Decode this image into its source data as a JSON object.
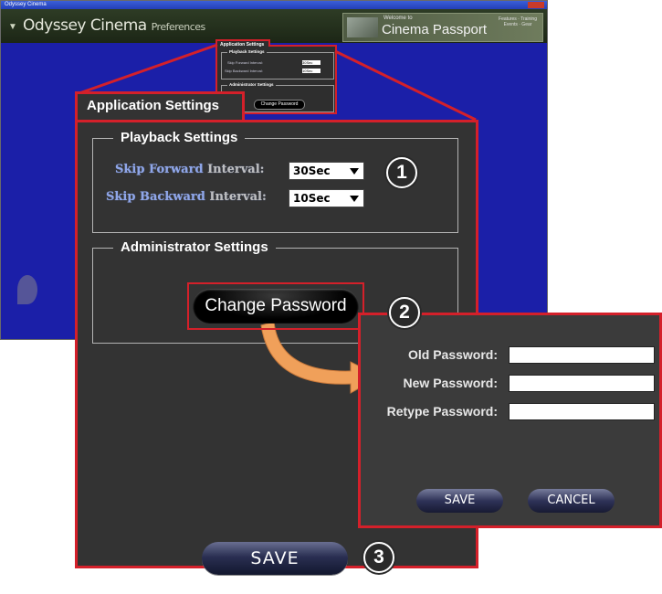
{
  "background_app": {
    "window_title": "Odyssey Cinema",
    "brand_name": "Odyssey Cinema",
    "brand_suffix": "Preferences",
    "passport_welcome": "Welcome to",
    "passport_name": "Cinema Passport",
    "passport_side": "Features · Training\nEvents · Gear"
  },
  "mini_dialog": {
    "tab": "Application Settings",
    "playback_legend": "Playback Settings",
    "skip_forward": "Skip Forward Interval:",
    "skip_backward": "Skip Backward Interval:",
    "skip_forward_value": "30Sec",
    "skip_backward_value": "10Sec",
    "admin_legend": "Administrator Settings",
    "change_password": "Change Password"
  },
  "dialog": {
    "tab_label": "Application Settings",
    "playback_legend": "Playback Settings",
    "skip_forward_label_a": "Skip Forward ",
    "skip_forward_label_b": "Interval:",
    "skip_forward_value": "30Sec",
    "skip_backward_label_a": "Skip Backward ",
    "skip_backward_label_b": "Interval:",
    "skip_backward_value": "10Sec",
    "admin_legend": "Administrator Settings",
    "change_password": "Change Password",
    "save": "SAVE"
  },
  "password_panel": {
    "old_password_label": "Old Password:",
    "new_password_label": "New Password:",
    "retype_password_label": "Retype Password:",
    "save": "SAVE",
    "cancel": "CANCEL"
  },
  "callouts": [
    "1",
    "2",
    "3"
  ],
  "colors": {
    "highlight_frame": "#d4202a",
    "dialog_bg": "#333333",
    "arrow": "#f0a05a"
  }
}
